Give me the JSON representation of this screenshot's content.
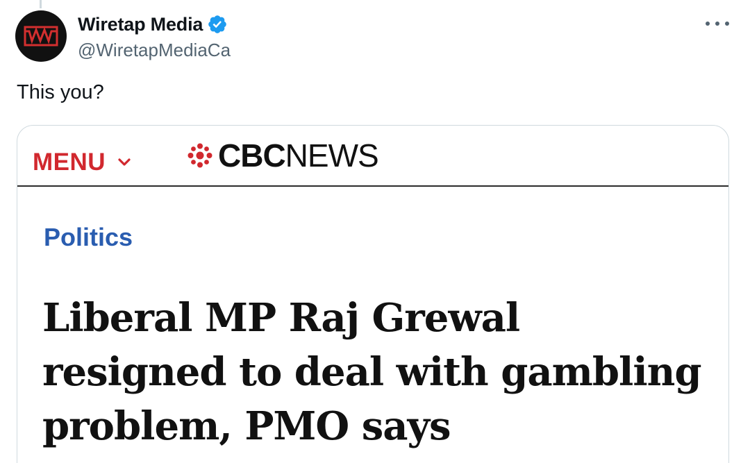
{
  "tweet": {
    "author": {
      "display_name": "Wiretap Media",
      "handle": "@WiretapMediaCa",
      "verified": true,
      "avatar_icon": "wiretap-logo-icon",
      "avatar_colors": {
        "background": "#111111",
        "accent": "#d32f2f"
      }
    },
    "more_icon": "more-horizontal-icon",
    "text": "This you?"
  },
  "embedded_image": {
    "header": {
      "menu_label": "MENU",
      "menu_icon": "chevron-down-icon",
      "logo_icon": "cbc-gem-icon",
      "logo_bold": "CBC",
      "logo_regular": "NEWS"
    },
    "section": "Politics",
    "headline": "Liberal MP Raj Grewal resigned to deal with gambling problem, PMO says",
    "colors": {
      "menu": "#d1282e",
      "section": "#2a5db0",
      "headline": "#111111"
    }
  },
  "colors": {
    "verified": "#1d9bf0",
    "secondary_text": "#536471",
    "border": "#cfd9de"
  }
}
